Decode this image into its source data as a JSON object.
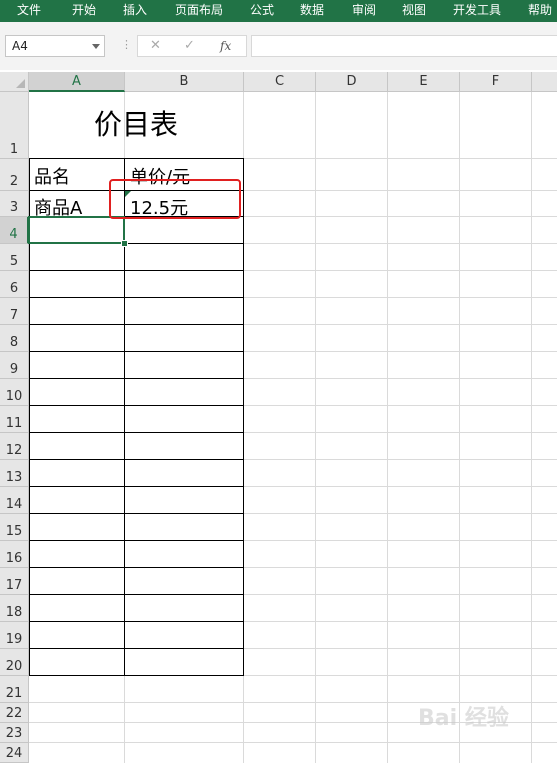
{
  "ribbon": {
    "tabs": [
      "文件",
      "开始",
      "插入",
      "页面布局",
      "公式",
      "数据",
      "审阅",
      "视图",
      "开发工具",
      "帮助"
    ]
  },
  "toolbar": {
    "name_box": "A4",
    "fx_label": "fx",
    "formula_value": ""
  },
  "columns": [
    "A",
    "B",
    "C",
    "D",
    "E",
    "F"
  ],
  "rows": [
    "1",
    "2",
    "3",
    "4",
    "5",
    "6",
    "7",
    "8",
    "9",
    "10",
    "11",
    "12",
    "13",
    "14",
    "15",
    "16",
    "17",
    "18",
    "19",
    "20",
    "21",
    "22",
    "23",
    "24"
  ],
  "sheet": {
    "title": "价目表",
    "header_name": "品名",
    "header_price": "单价/元",
    "item_name": "商品A",
    "item_price": "12.5元"
  },
  "selection": "A4",
  "watermark": "Bai 经验",
  "colors": {
    "accent": "#217346",
    "highlight": "#e02020"
  }
}
